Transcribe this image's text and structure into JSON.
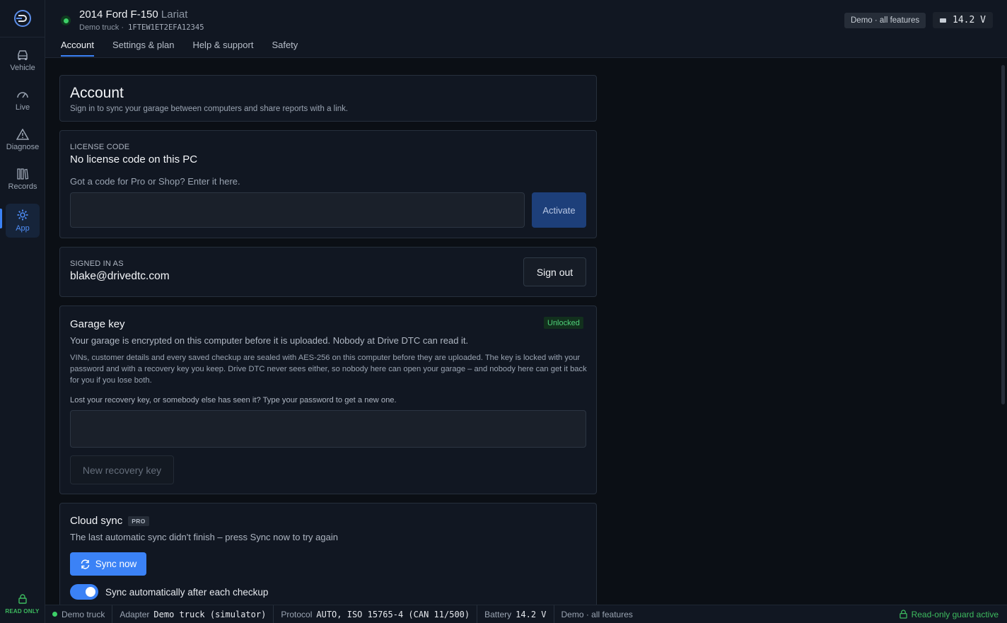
{
  "sidebar": {
    "items": [
      {
        "label": "Vehicle",
        "icon": "car-icon"
      },
      {
        "label": "Live",
        "icon": "gauge-icon"
      },
      {
        "label": "Diagnose",
        "icon": "warning-icon"
      },
      {
        "label": "Records",
        "icon": "books-icon"
      },
      {
        "label": "App",
        "icon": "gear-icon",
        "active": true
      }
    ],
    "readonly_label": "READ ONLY"
  },
  "header": {
    "vehicle_name": "2014 Ford F-150",
    "vehicle_trim": "Lariat",
    "vehicle_tag": "Demo truck",
    "vin": "1FTEW1ET2EFA12345",
    "mode_badge": "Demo · all features",
    "voltage": "14.2 V",
    "tabs": [
      "Account",
      "Settings & plan",
      "Help & support",
      "Safety"
    ]
  },
  "account": {
    "title": "Account",
    "subtitle": "Sign in to sync your garage between computers and share reports with a link."
  },
  "license": {
    "caption": "LICENSE CODE",
    "status": "No license code on this PC",
    "prompt": "Got a code for Pro or Shop? Enter it here.",
    "input_value": "",
    "activate_label": "Activate"
  },
  "signin": {
    "caption": "SIGNED IN AS",
    "email": "blake@drivedtc.com",
    "signout_label": "Sign out"
  },
  "garage_key": {
    "title": "Garage key",
    "badge": "Unlocked",
    "lead": "Your garage is encrypted on this computer before it is uploaded. Nobody at Drive DTC can read it.",
    "detail": "VINs, customer details and every saved checkup are sealed with AES-256 on this computer before they are uploaded. The key is locked with your password and with a recovery key you keep. Drive DTC never sees either, so nobody here can open your garage – and nobody here can get it back for you if you lose both.",
    "recovery_prompt": "Lost your recovery key, or somebody else has seen it? Type your password to get a new one.",
    "password_value": "",
    "new_key_label": "New recovery key"
  },
  "cloud_sync": {
    "title": "Cloud sync",
    "badge": "PRO",
    "status": "The last automatic sync didn't finish – press Sync now to try again",
    "sync_label": "Sync now",
    "auto_label": "Sync automatically after each checkup",
    "auto_enabled": true
  },
  "statusbar": {
    "vehicle": "Demo truck",
    "adapter_label": "Adapter",
    "adapter_value": "Demo truck (simulator)",
    "protocol_label": "Protocol",
    "protocol_value": "AUTO, ISO 15765-4 (CAN 11/500)",
    "battery_label": "Battery",
    "battery_value": "14.2 V",
    "mode": "Demo · all features",
    "guard": "Read-only guard active"
  },
  "colors": {
    "accent": "#3b82f6",
    "success": "#3dd068",
    "background": "#0b0f15",
    "panel": "#111722"
  }
}
